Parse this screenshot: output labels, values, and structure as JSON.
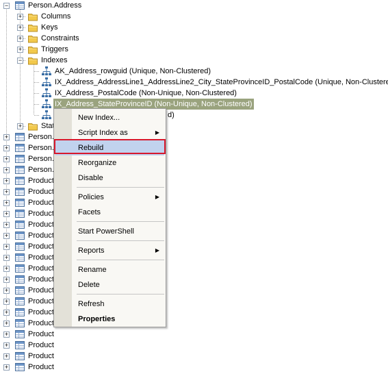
{
  "tree": {
    "table_name": "Person.Address",
    "folders": [
      "Columns",
      "Keys",
      "Constraints",
      "Triggers",
      "Indexes"
    ],
    "indexes": [
      "AK_Address_rowguid (Unique, Non-Clustered)",
      "IX_Address_AddressLine1_AddressLine2_City_StateProvinceID_PostalCode (Unique, Non-Clustered)",
      "IX_Address_PostalCode (Non-Unique, Non-Clustered)",
      "IX_Address_StateProvinceID (Non-Unique, Non-Clustered)"
    ],
    "partial_index_text": "d)",
    "statistics_partial": "Stat",
    "person_rows": [
      "Person.",
      "Person.",
      "Person.",
      "Person."
    ],
    "product_rows": [
      "Product",
      "Product",
      "Product",
      "Product",
      "Product",
      "Product",
      "Product",
      "Product",
      "Product",
      "Product",
      "Product",
      "Product",
      "Product",
      "Product",
      "Product",
      "Product",
      "Product",
      "Product"
    ]
  },
  "context_menu": {
    "new_index": "New Index...",
    "script_index_as": "Script Index as",
    "rebuild": "Rebuild",
    "reorganize": "Reorganize",
    "disable": "Disable",
    "policies": "Policies",
    "facets": "Facets",
    "start_powershell": "Start PowerShell",
    "reports": "Reports",
    "rename": "Rename",
    "delete": "Delete",
    "refresh": "Refresh",
    "properties": "Properties"
  },
  "colors": {
    "selection": "#9aa37e",
    "menu_highlight": "#c1d2ee",
    "callout_border": "#d8182c",
    "folder": "#f2c94c",
    "index_icon": "#3a6ea5"
  }
}
